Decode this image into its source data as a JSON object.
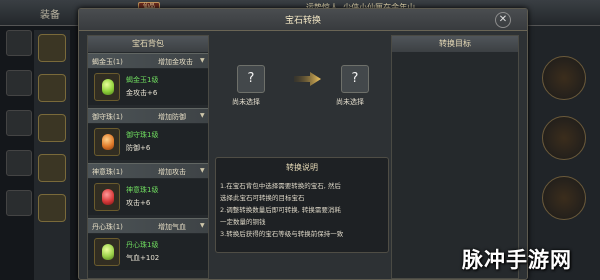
{
  "background": {
    "equip_label": "装备",
    "level_badge": "仙品",
    "notice": "运势惊人, 少侠小仙匣在余年山"
  },
  "dialog": {
    "title": "宝石转换",
    "close": "✕"
  },
  "bag": {
    "title": "宝石背包",
    "categories": [
      {
        "name": "蝎金玉(1)",
        "action": "增加金攻击",
        "item_name": "蝎金玉1级",
        "item_stat": "金攻击+6",
        "gem_color": "#8fd13a"
      },
      {
        "name": "御守珠(1)",
        "action": "增加防御",
        "item_name": "御守珠1级",
        "item_stat": "防御+6",
        "gem_color": "#e07a2a"
      },
      {
        "name": "神意珠(1)",
        "action": "增加攻击",
        "item_name": "神意珠1级",
        "item_stat": "攻击+6",
        "gem_color": "#d83a3a"
      },
      {
        "name": "丹心珠(1)",
        "action": "增加气血",
        "item_name": "丹心珠1级",
        "item_stat": "气血+102",
        "gem_color": "#9bd04a"
      }
    ]
  },
  "transform": {
    "source_symbol": "?",
    "source_label": "尚未选择",
    "target_symbol": "?",
    "target_label": "尚未选择"
  },
  "info": {
    "title": "转换说明",
    "lines": [
      "1.在宝石背包中选择需要转换的宝石, 然后",
      "选择此宝石可转换的目标宝石",
      "2.调整转换数量后即可转换, 转换需要消耗",
      "一定数量的铜钱",
      "3.转换后获得的宝石等级与转换前保持一致"
    ]
  },
  "target": {
    "title": "转换目标"
  },
  "watermark": {
    "text": "脉冲手游网"
  },
  "colors": {
    "item_name": "#6fdc5f",
    "panel_bg": "#25292c",
    "header_text": "#e8dcb8"
  }
}
